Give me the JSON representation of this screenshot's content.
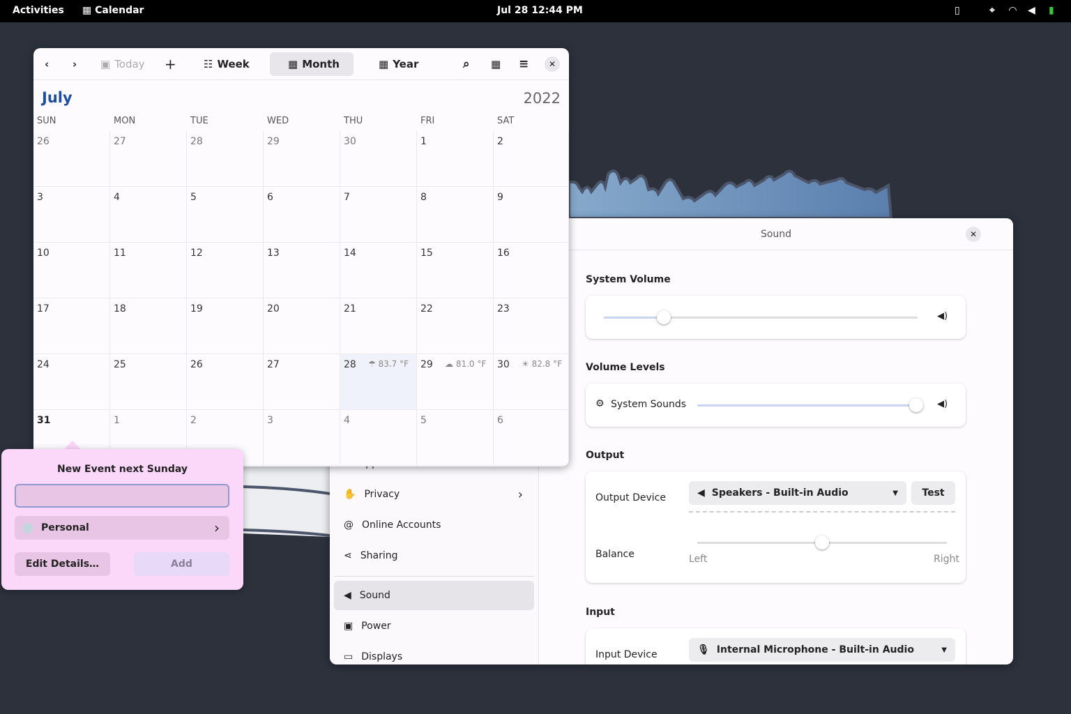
{
  "topbar": {
    "activities": "Activities",
    "app": "Calendar",
    "clock": "Jul 28  12:44 PM",
    "icons": [
      "clipboard-icon",
      "location-icon",
      "wifi-icon",
      "volume-icon",
      "battery-charging-icon"
    ]
  },
  "calendar": {
    "toolbar": {
      "today": "Today",
      "week": "Week",
      "month": "Month",
      "year": "Year"
    },
    "month": "July",
    "year": "2022",
    "weekdays": [
      "SUN",
      "MON",
      "TUE",
      "WED",
      "THU",
      "FRI",
      "SAT"
    ],
    "weeks": [
      [
        "26",
        "27",
        "28",
        "29",
        "30",
        "1",
        "2"
      ],
      [
        "3",
        "4",
        "5",
        "6",
        "7",
        "8",
        "9"
      ],
      [
        "10",
        "11",
        "12",
        "13",
        "14",
        "15",
        "16"
      ],
      [
        "17",
        "18",
        "19",
        "20",
        "21",
        "22",
        "23"
      ],
      [
        "24",
        "25",
        "26",
        "27",
        "28",
        "29",
        "30"
      ],
      [
        "31",
        "1",
        "2",
        "3",
        "4",
        "5",
        "6"
      ]
    ],
    "weather": [
      {
        "day": "28",
        "temp": "83.7 °F",
        "icon": "rain-icon"
      },
      {
        "day": "29",
        "temp": "81.0 °F",
        "icon": "cloudy-icon"
      },
      {
        "day": "30",
        "temp": "82.8 °F",
        "icon": "partly-sunny-icon"
      }
    ],
    "accent": "#1c4ea3"
  },
  "popover": {
    "title": "New Event next Sunday",
    "input_value": "",
    "calendar": "Personal",
    "edit": "Edit Details…",
    "add": "Add"
  },
  "settings": {
    "title": "Sound",
    "sidebar": [
      {
        "label": "Applications",
        "icon": "apps-icon"
      },
      {
        "label": "Privacy",
        "icon": "hand-icon"
      },
      {
        "label": "Online Accounts",
        "icon": "at-icon"
      },
      {
        "label": "Sharing",
        "icon": "share-icon"
      },
      {
        "label": "Sound",
        "icon": "speaker-icon",
        "selected": true
      },
      {
        "label": "Power",
        "icon": "power-icon"
      },
      {
        "label": "Displays",
        "icon": "display-icon"
      }
    ],
    "system_volume": {
      "label": "System Volume",
      "level": 0.18
    },
    "volume_levels": {
      "label": "Volume Levels",
      "item": "System Sounds",
      "level": 1.0
    },
    "output": {
      "label": "Output",
      "device_label": "Output Device",
      "device": "Speakers - Built-in Audio",
      "test": "Test",
      "balance_label": "Balance",
      "left": "Left",
      "right": "Right",
      "balance": 0.5
    },
    "input": {
      "label": "Input",
      "device_label": "Input Device",
      "device": "Internal Microphone - Built-in Audio"
    }
  }
}
